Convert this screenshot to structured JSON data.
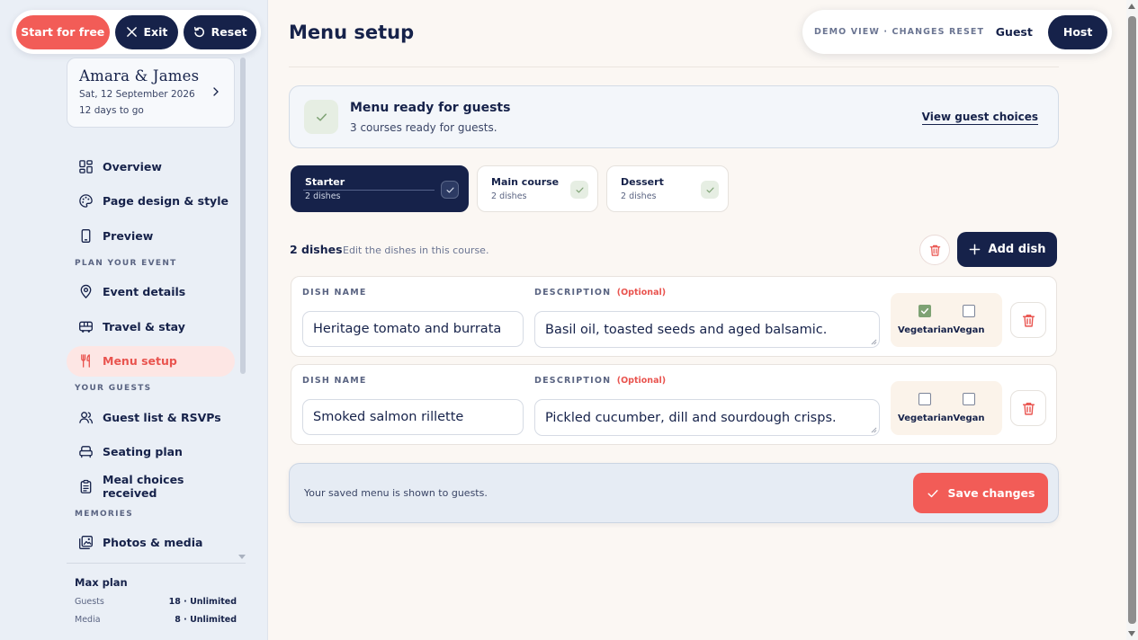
{
  "topbar": {
    "start_label": "Start for free",
    "exit_label": "Exit",
    "reset_label": "Reset"
  },
  "event": {
    "title": "Amara & James",
    "date": "Sat, 12 September 2026",
    "countdown": "12 days to go"
  },
  "nav": {
    "overview": "Overview",
    "page_design": "Page design & style",
    "preview": "Preview",
    "section_plan": "PLAN YOUR EVENT",
    "event_details": "Event details",
    "travel": "Travel & stay",
    "menu_setup": "Menu setup",
    "section_guests": "YOUR GUESTS",
    "guest_list": "Guest list & RSVPs",
    "seating": "Seating plan",
    "meal_choices": "Meal choices received",
    "section_memories": "MEMORIES",
    "photos": "Photos & media"
  },
  "plan": {
    "title": "Max plan",
    "guests_label": "Guests",
    "guests_value": "18 · Unlimited",
    "media_label": "Media",
    "media_value": "8 · Unlimited"
  },
  "header": {
    "title": "Menu setup"
  },
  "viewbar": {
    "demo_label": "DEMO VIEW · CHANGES RESET",
    "guest_label": "Guest",
    "host_label": "Host"
  },
  "status": {
    "title": "Menu ready for guests",
    "subtitle": "3 courses ready for guests.",
    "link": "View guest choices"
  },
  "courses": [
    {
      "name": "Starter",
      "count": "2 dishes"
    },
    {
      "name": "Main course",
      "count": "2 dishes"
    },
    {
      "name": "Dessert",
      "count": "2 dishes"
    }
  ],
  "dishes_header": {
    "count": "2 dishes",
    "hint": "Edit the dishes in this course.",
    "add_label": "Add dish"
  },
  "dish_labels": {
    "name": "DISH NAME",
    "description": "DESCRIPTION",
    "optional": "(Optional)",
    "vegetarian": "Vegetarian",
    "vegan": "Vegan"
  },
  "dishes": [
    {
      "name": "Heritage tomato and burrata",
      "description": "Basil oil, toasted seeds and aged balsamic.",
      "vegetarian": true,
      "vegan": false
    },
    {
      "name": "Smoked salmon rillette",
      "description": "Pickled cucumber, dill and sourdough crisps.",
      "vegetarian": false,
      "vegan": false
    }
  ],
  "save": {
    "note": "Your saved menu is shown to guests.",
    "label": "Save changes"
  },
  "colors": {
    "navy": "#16224a",
    "coral": "#f25c57",
    "sage": "#7ea274",
    "sidebar_bg": "#eaeff6",
    "page_bg": "#fbf7f3"
  }
}
